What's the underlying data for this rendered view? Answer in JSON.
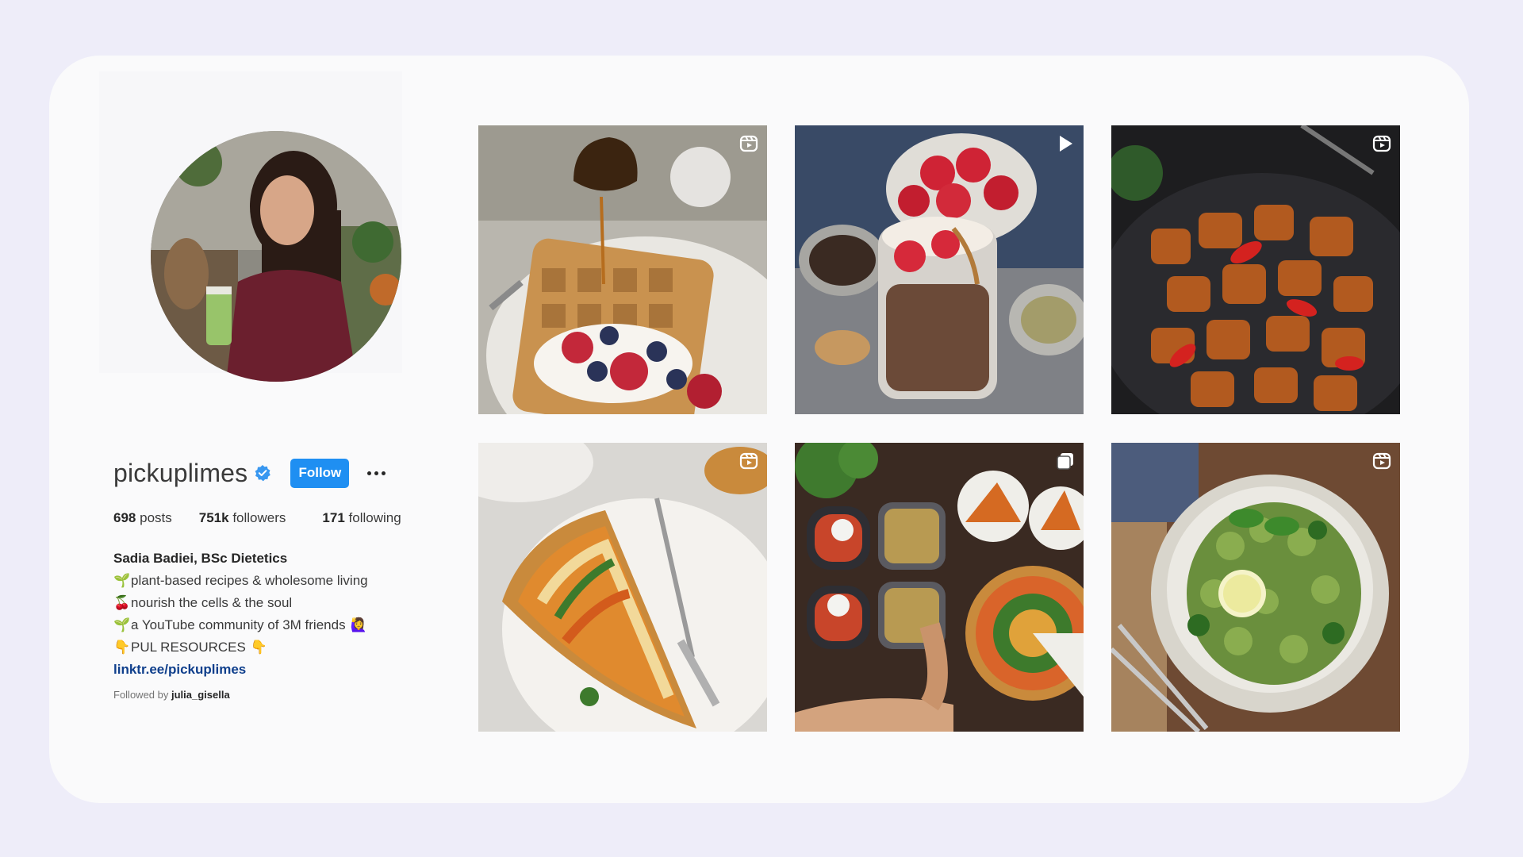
{
  "profile": {
    "username": "pickuplimes",
    "follow_label": "Follow",
    "stats": {
      "posts_count": "698",
      "posts_label": "posts",
      "followers_count": "751k",
      "followers_label": "followers",
      "following_count": "171",
      "following_label": "following"
    },
    "bio": {
      "full_name": "Sadia Badiei, BSc Dietetics",
      "lines": [
        {
          "emoji": "🌱",
          "text": "plant-based recipes & wholesome living"
        },
        {
          "emoji": "🍒",
          "text": "nourish the cells & the soul"
        },
        {
          "emoji": "🌱",
          "text": "a YouTube community of 3M friends",
          "trailing_emoji": "🙋‍♀️"
        },
        {
          "emoji": "👇",
          "text": "PUL RESOURCES",
          "trailing_emoji": "👇"
        }
      ],
      "link": "linktr.ee/pickuplimes"
    },
    "followed_by_prefix": "Followed by",
    "followed_by_user": "julia_gisella"
  },
  "posts": [
    {
      "subject": "waffle with berries and syrup",
      "media_icon": "reel-icon"
    },
    {
      "subject": "overnight oats jar with strawberries",
      "media_icon": "play-icon"
    },
    {
      "subject": "glazed tofu bites with peppers",
      "media_icon": "reel-icon"
    },
    {
      "subject": "vegetable tart slice",
      "media_icon": "reel-icon"
    },
    {
      "subject": "meal prep containers and spiral tart",
      "media_icon": "carousel-icon"
    },
    {
      "subject": "green pesto pasta with lemon",
      "media_icon": "reel-icon"
    }
  ],
  "colors": {
    "page_background": "#eeedf9",
    "card_background": "#fafafb",
    "follow_button": "#1f8ff2",
    "verified_badge": "#3897f0",
    "link": "#0f3f8c"
  }
}
